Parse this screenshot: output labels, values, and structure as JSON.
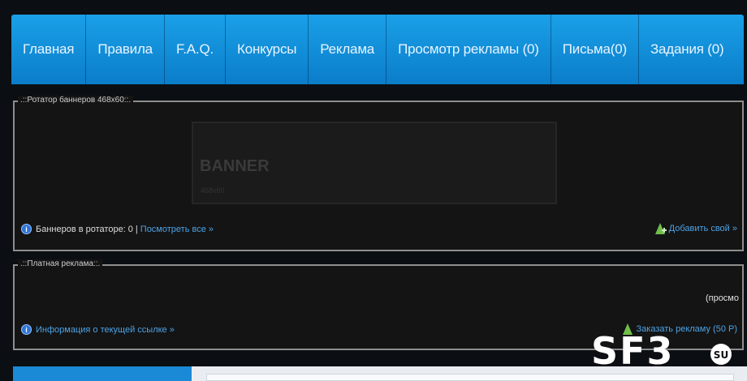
{
  "nav": {
    "items": [
      "Главная",
      "Правила",
      "F.A.Q.",
      "Конкурсы",
      "Реклама",
      "Просмотр рекламы (0)",
      "Письма(0)",
      "Задания (0)"
    ]
  },
  "rotator": {
    "legend": ".::Ротатор баннеров 468x60::.",
    "banner_title": "BANNER",
    "banner_size": "468x60",
    "count_text": "Баннеров в ротаторе: 0",
    "separator": "|",
    "view_all": "Посмотреть все »",
    "add_own": "Добавить свой »"
  },
  "paid_ads": {
    "legend": ".::Платная реклама::.",
    "cut_text": "(просмо",
    "info_link": "Информация о текущей ссылке »",
    "order_link": "Заказать рекламу (50 Р)"
  },
  "logo": {
    "text": "SF3",
    "badge": "SU"
  },
  "colors": {
    "nav_bg": "#1393de",
    "panel_bg": "#141414",
    "link": "#4ca3e6"
  }
}
